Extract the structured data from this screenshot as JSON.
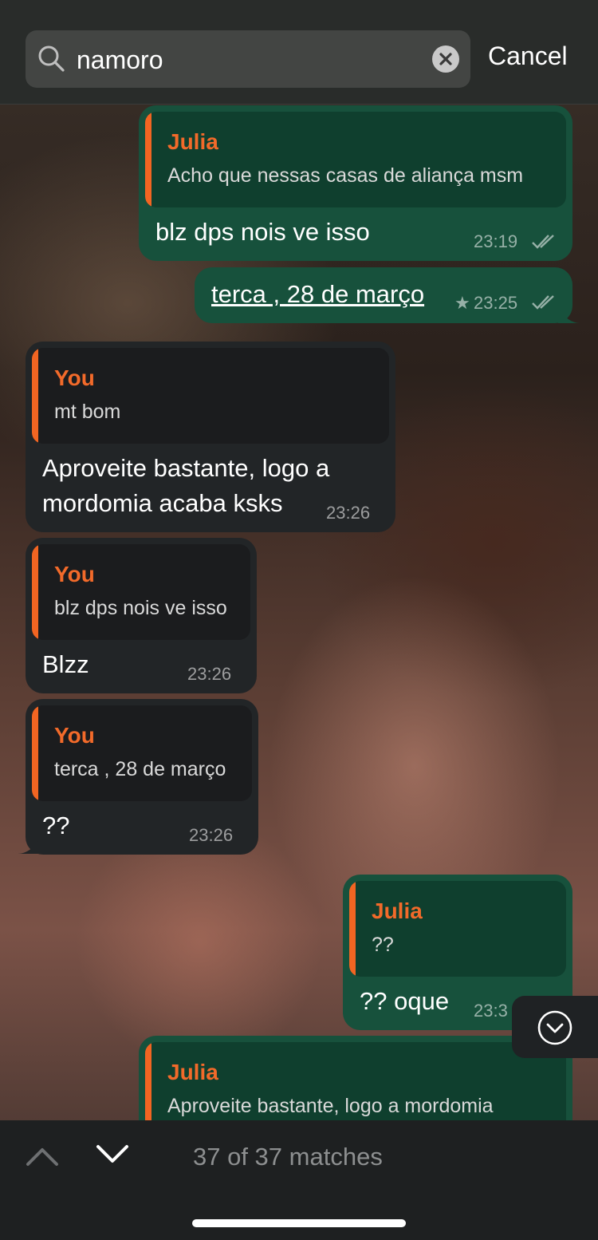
{
  "search": {
    "query": "namoro",
    "cancel_label": "Cancel",
    "icon": "search-icon",
    "clear_icon": "clear-icon"
  },
  "messages": [
    {
      "direction": "outgoing",
      "quote_name": "Julia",
      "quote_text": "Acho que nessas casas de aliança msm",
      "text": "blz dps nois ve isso",
      "time": "23:19",
      "status": "read"
    },
    {
      "direction": "outgoing",
      "text": "terca , 28 de março",
      "starred": true,
      "star": "★",
      "time": "23:25",
      "status": "read"
    },
    {
      "direction": "incoming",
      "quote_name": "You",
      "quote_text": "mt bom",
      "text_line1": "Aproveite bastante, logo a",
      "text_line2": "mordomia acaba ksks",
      "time": "23:26"
    },
    {
      "direction": "incoming",
      "quote_name": "You",
      "quote_text": "blz dps nois ve isso",
      "text": "Blzz",
      "time": "23:26"
    },
    {
      "direction": "incoming",
      "quote_name": "You",
      "quote_text": "terca , 28 de março",
      "text": "??",
      "time": "23:26"
    },
    {
      "direction": "outgoing",
      "quote_name": "Julia",
      "quote_text": "??",
      "text": "?? oque",
      "time": "23:3"
    },
    {
      "direction": "outgoing",
      "quote_name": "Julia",
      "quote_text": "Aproveite bastante, logo a mordomia"
    }
  ],
  "navigation": {
    "match_status": "37 of 37 matches",
    "prev_icon": "chevron-up-icon",
    "next_icon": "chevron-down-icon",
    "scroll_down_icon": "scroll-down-icon"
  },
  "colors": {
    "outgoing_bubble": "#17513c",
    "incoming_bubble": "#222527",
    "quote_accent": "#f26522"
  }
}
